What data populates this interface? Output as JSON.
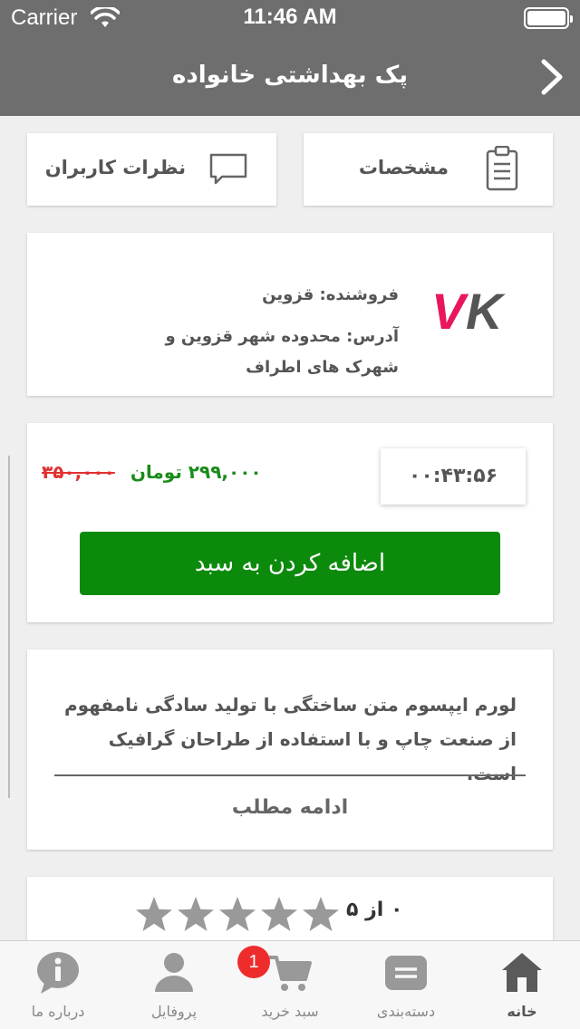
{
  "status_bar": {
    "carrier": "Carrier",
    "time": "11:46 AM"
  },
  "header": {
    "title": "پک بهداشتی خانواده"
  },
  "tabs": {
    "specs": "مشخصات",
    "comments": "نظرات کاربران"
  },
  "seller": {
    "logo_text": "VK",
    "name": "فروشنده: قزوین",
    "address": "آدرس: محدوده شهر قزوین و شهرک های اطراف"
  },
  "offer": {
    "countdown": "۰۰:۴۳:۵۶",
    "old_price": "۳۵۰,۰۰۰",
    "new_price": "۲۹۹,۰۰۰ تومان",
    "add_to_cart": "اضافه کردن به سبد"
  },
  "description": {
    "text": "لورم ایپسوم متن ساختگی با تولید سادگی نامفهوم از صنعت چاپ و با استفاده از طراحان گرافیک است.",
    "read_more": "ادامه مطلب"
  },
  "rating": {
    "text": "۰ از ۵",
    "value": 0,
    "max": 5
  },
  "tab_bar": {
    "home": "خانه",
    "categories": "دسته‌بندی",
    "cart": "سبد خرید",
    "profile": "پروفایل",
    "about": "درباره ما",
    "cart_badge": "1"
  },
  "colors": {
    "header_bg": "#6e6e6e",
    "button_green": "#0c8a0c",
    "price_green": "#1a8c1a",
    "old_price_red": "#e03030",
    "badge_red": "#ee2c2c"
  }
}
